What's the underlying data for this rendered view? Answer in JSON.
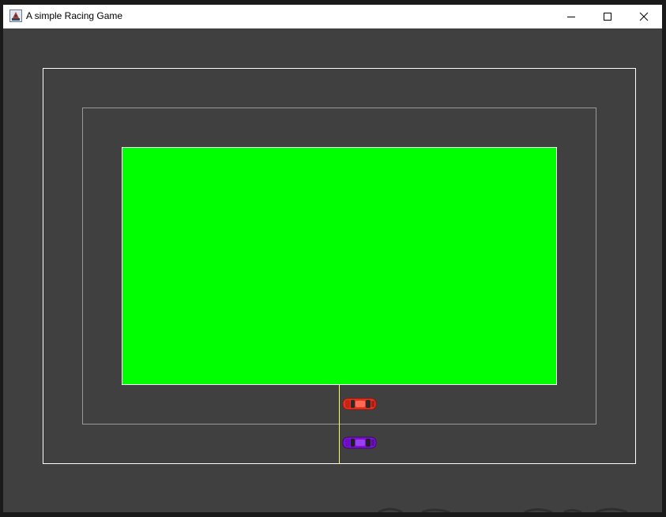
{
  "window": {
    "title": "A simple Racing Game",
    "controls": {
      "minimize": "minimize",
      "maximize": "maximize",
      "close": "close"
    }
  },
  "game": {
    "colors": {
      "track": "#404040",
      "grass": "#00ff00",
      "outer_boundary": "#ffffff",
      "inner_boundary": "#9a9a9a",
      "start_line": "#ffff66"
    },
    "cars": [
      {
        "name": "red-car",
        "color": "#e8311e"
      },
      {
        "name": "purple-car",
        "color": "#7b12d6"
      }
    ]
  }
}
